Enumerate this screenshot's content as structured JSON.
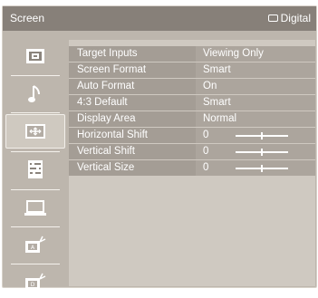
{
  "header": {
    "title": "Screen",
    "source_label": "Digital"
  },
  "sidebar": {
    "items": [
      {
        "icon": "picture-icon"
      },
      {
        "icon": "music-note-icon"
      },
      {
        "icon": "screen-icon",
        "selected": true
      },
      {
        "icon": "setup-list-icon"
      },
      {
        "icon": "pc-display-icon"
      },
      {
        "icon": "input-a-icon",
        "badge": "A"
      },
      {
        "icon": "input-d-icon",
        "badge": "D"
      }
    ]
  },
  "settings": [
    {
      "label": "Target Inputs",
      "value": "Viewing Only"
    },
    {
      "label": "Screen Format",
      "value": "Smart"
    },
    {
      "label": "Auto Format",
      "value": "On"
    },
    {
      "label": "4:3 Default",
      "value": "Smart"
    },
    {
      "label": "Display Area",
      "value": "Normal"
    },
    {
      "label": "Horizontal Shift",
      "value": "0",
      "slider_fraction": 0.5
    },
    {
      "label": "Vertical Shift",
      "value": "0",
      "slider_fraction": 0.5
    },
    {
      "label": "Vertical Size",
      "value": "0",
      "slider_fraction": 0.5
    }
  ]
}
